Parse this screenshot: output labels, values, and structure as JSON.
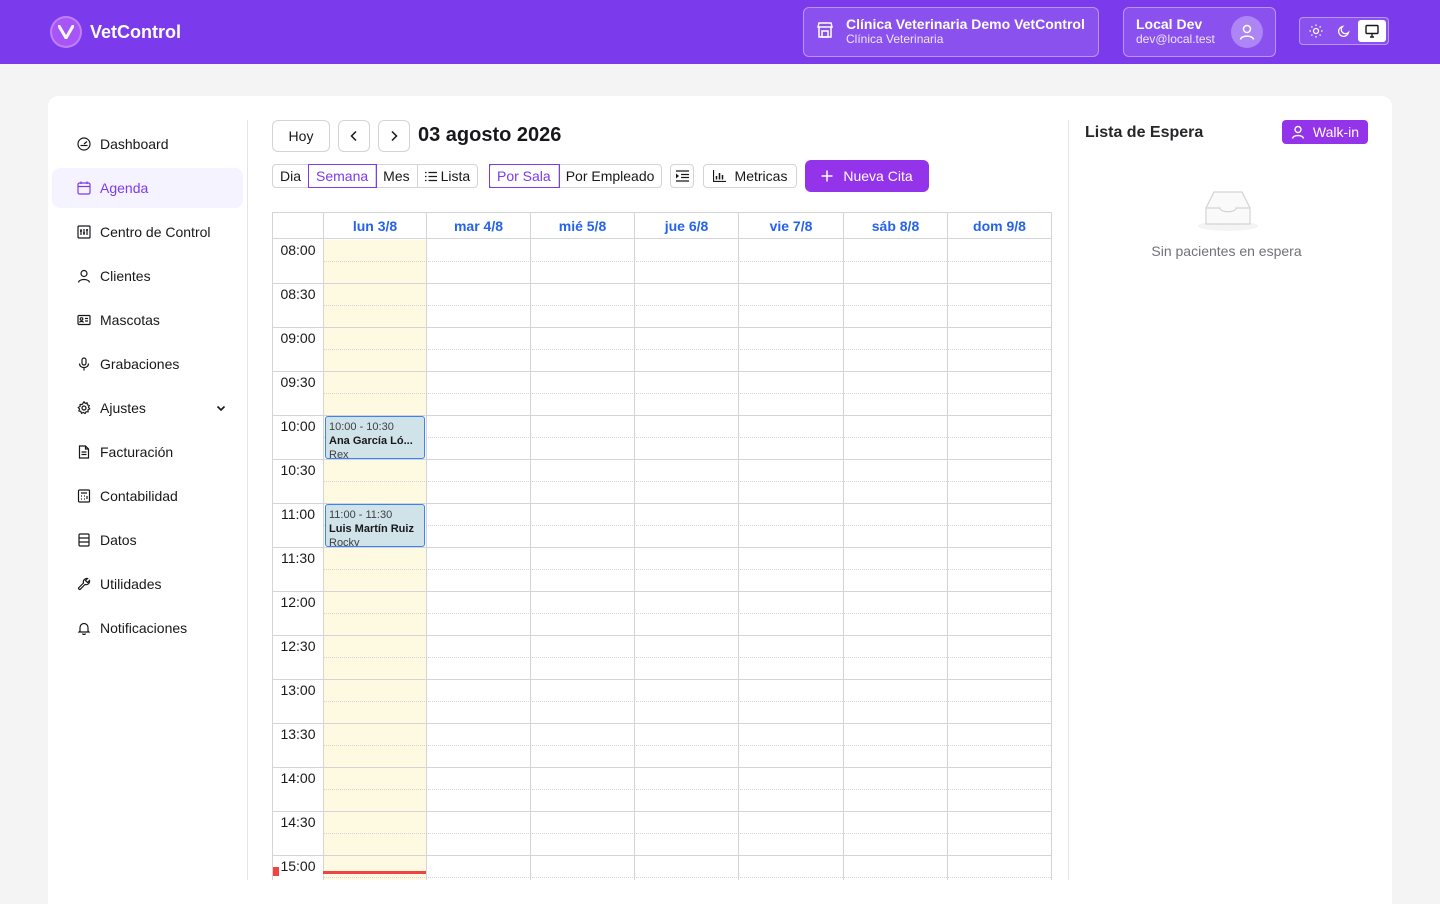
{
  "header": {
    "app_name": "VetControl",
    "clinic_name": "Clínica Veterinaria Demo VetControl",
    "clinic_type": "Clínica Veterinaria",
    "user_name": "Local Dev",
    "user_email": "dev@local.test"
  },
  "sidebar": {
    "items": [
      {
        "label": "Dashboard",
        "icon": "gauge-icon"
      },
      {
        "label": "Agenda",
        "icon": "calendar-icon"
      },
      {
        "label": "Centro de Control",
        "icon": "control-panel-icon"
      },
      {
        "label": "Clientes",
        "icon": "user-icon"
      },
      {
        "label": "Mascotas",
        "icon": "id-card-icon"
      },
      {
        "label": "Grabaciones",
        "icon": "microphone-icon"
      },
      {
        "label": "Ajustes",
        "icon": "gear-icon"
      },
      {
        "label": "Facturación",
        "icon": "document-icon"
      },
      {
        "label": "Contabilidad",
        "icon": "calculator-icon"
      },
      {
        "label": "Datos",
        "icon": "database-icon"
      },
      {
        "label": "Utilidades",
        "icon": "wrench-icon"
      },
      {
        "label": "Notificaciones",
        "icon": "bell-icon"
      }
    ]
  },
  "calendar": {
    "today_label": "Hoy",
    "title": "03 agosto 2026",
    "views": [
      "Dia",
      "Semana",
      "Mes",
      "Lista"
    ],
    "active_view": "Semana",
    "groupings": [
      "Por Sala",
      "Por Empleado"
    ],
    "active_grouping": "Por Sala",
    "metrics_label": "Metricas",
    "new_label": "Nueva Cita",
    "days": [
      "lun 3/8",
      "mar 4/8",
      "mié 5/8",
      "jue 6/8",
      "vie 7/8",
      "sáb 8/8",
      "dom 9/8"
    ],
    "times": [
      "08:00",
      "08:30",
      "09:00",
      "09:30",
      "10:00",
      "10:30",
      "11:00",
      "11:30",
      "12:00",
      "12:30",
      "13:00",
      "13:30",
      "14:00",
      "14:30",
      "15:00"
    ],
    "events": [
      {
        "time": "10:00 - 10:30",
        "client": "Ana García Ló...",
        "pet": "Rex"
      },
      {
        "time": "11:00 - 11:30",
        "client": "Luis Martín Ruiz",
        "pet": "Rocky"
      }
    ]
  },
  "waitlist": {
    "title": "Lista de Espera",
    "walkin_label": "Walk-in",
    "empty_text": "Sin pacientes en espera"
  },
  "colors": {
    "brand": "#7c3aed",
    "accent": "#9333ea",
    "day_header": "#2563eb",
    "today_column": "#fef9e1",
    "event_bg": "#cfe3e8",
    "now_line": "#ef4444"
  }
}
